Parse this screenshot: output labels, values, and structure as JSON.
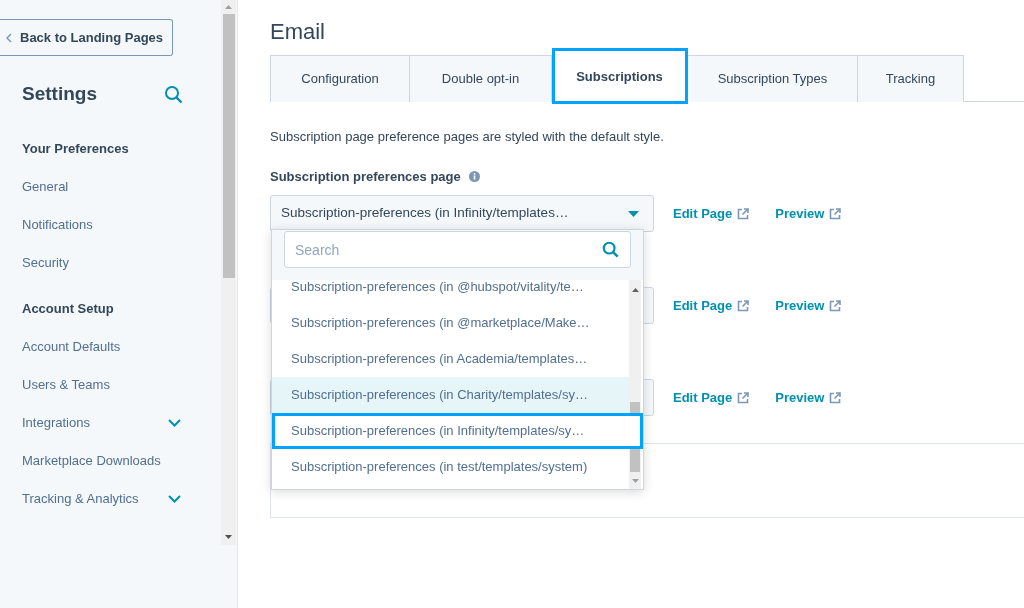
{
  "sidebar": {
    "back_button": "Back to Landing Pages",
    "title": "Settings",
    "sections": [
      {
        "heading": "Your Preferences",
        "items": [
          {
            "label": "General",
            "expandable": false
          },
          {
            "label": "Notifications",
            "expandable": false
          },
          {
            "label": "Security",
            "expandable": false
          }
        ]
      },
      {
        "heading": "Account Setup",
        "items": [
          {
            "label": "Account Defaults",
            "expandable": false
          },
          {
            "label": "Users & Teams",
            "expandable": false
          },
          {
            "label": "Integrations",
            "expandable": true
          },
          {
            "label": "Marketplace Downloads",
            "expandable": false
          },
          {
            "label": "Tracking & Analytics",
            "expandable": true
          }
        ]
      }
    ]
  },
  "main": {
    "title": "Email",
    "tabs": [
      {
        "label": "Configuration",
        "selected": false,
        "outlined": false
      },
      {
        "label": "Double opt-in",
        "selected": false,
        "outlined": false
      },
      {
        "label": "Subscriptions",
        "selected": true,
        "outlined": true
      },
      {
        "label": "Subscription Types",
        "selected": false,
        "outlined": false
      },
      {
        "label": "Tracking",
        "selected": false,
        "outlined": false
      }
    ],
    "description": "Subscription page preference pages are styled with the default style.",
    "field_label": "Subscription preferences page",
    "rows": [
      {
        "value": "Subscription-preferences (in Infinity/templates…",
        "links": [
          "Edit Page",
          "Preview"
        ]
      },
      {
        "links": [
          "Edit Page",
          "Preview"
        ]
      },
      {
        "links": [
          "Edit Page",
          "Preview"
        ]
      }
    ],
    "dropdown": {
      "search_placeholder": "Search",
      "options": [
        {
          "label": "Subscription-preferences (in @hubspot/vitality/te…",
          "highlighted": false,
          "outlined": false
        },
        {
          "label": "Subscription-preferences (in @marketplace/Make…",
          "highlighted": false,
          "outlined": false
        },
        {
          "label": "Subscription-preferences (in Academia/templates…",
          "highlighted": false,
          "outlined": false
        },
        {
          "label": "Subscription-preferences (in Charity/templates/sy…",
          "highlighted": true,
          "outlined": false
        },
        {
          "label": "Subscription-preferences (in Infinity/templates/sy…",
          "highlighted": false,
          "outlined": true
        },
        {
          "label": "Subscription-preferences (in test/templates/system)",
          "highlighted": false,
          "outlined": false
        }
      ]
    }
  }
}
